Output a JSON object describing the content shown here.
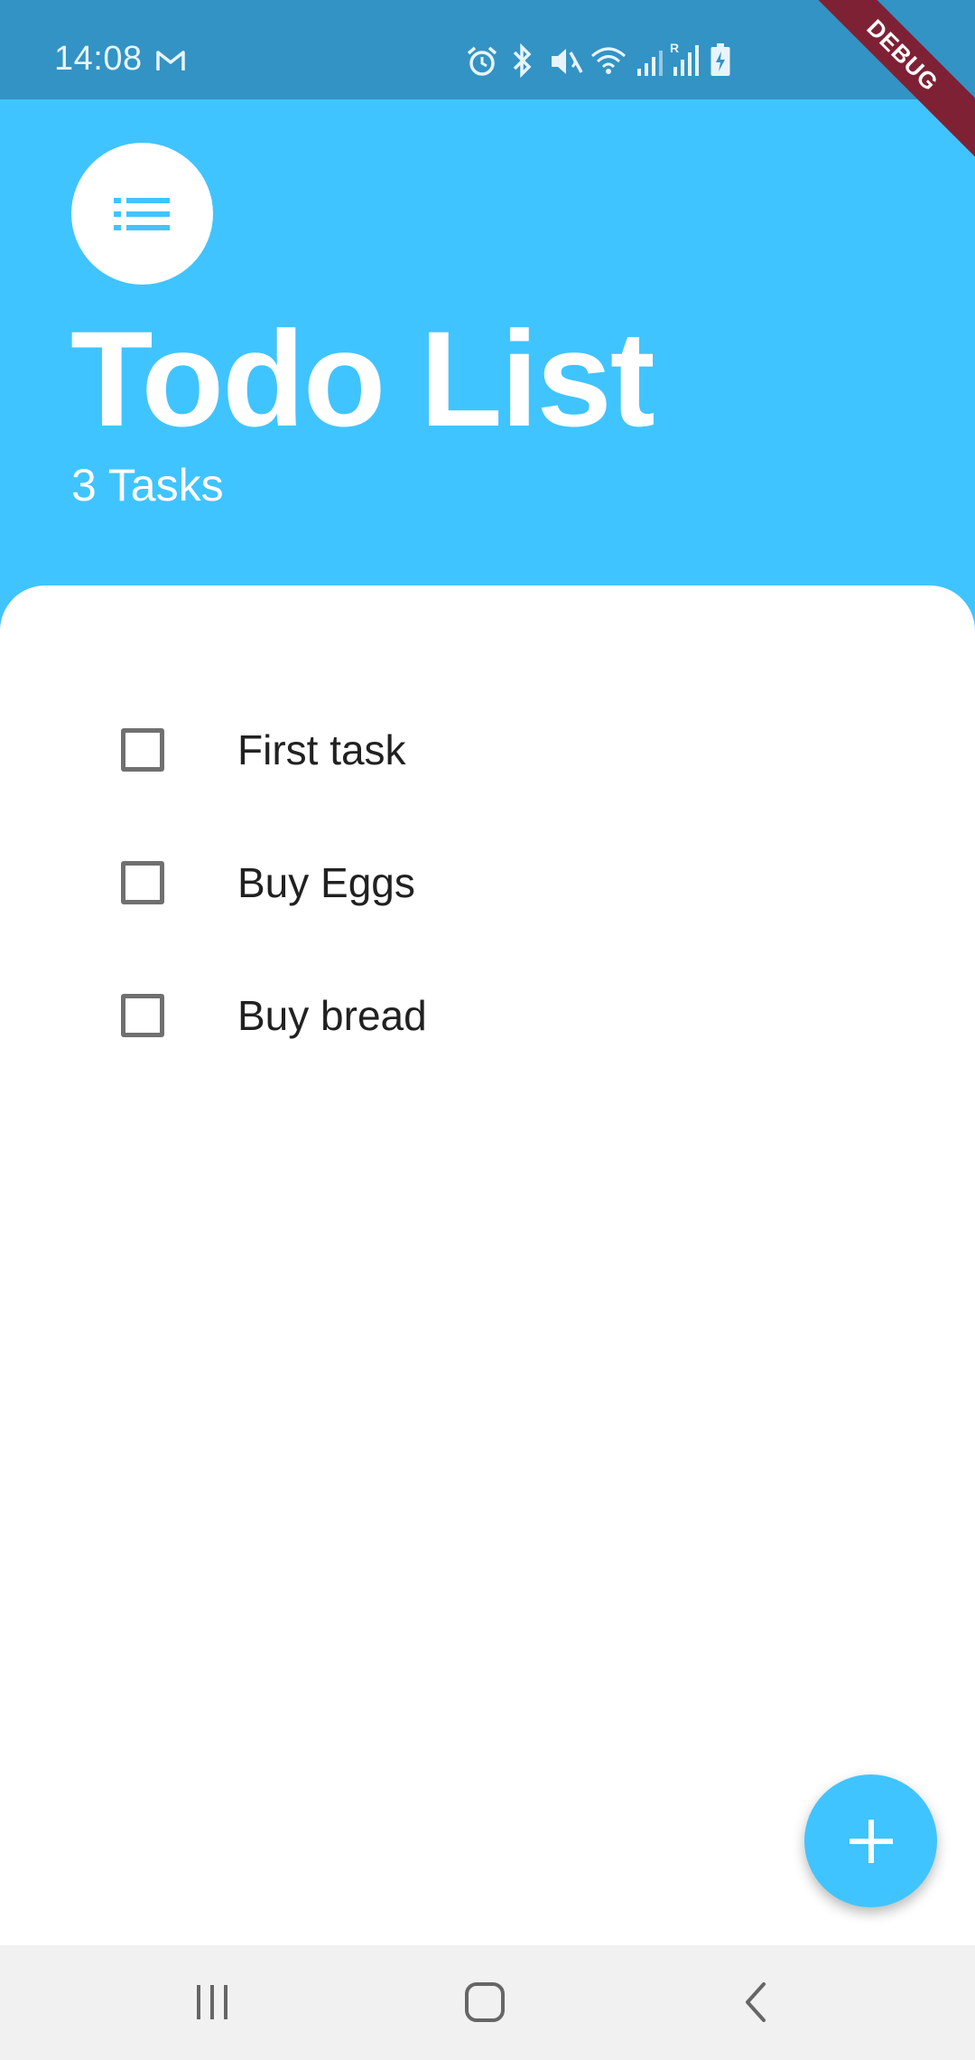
{
  "status_bar": {
    "time": "14:08",
    "icons": [
      "gmail-icon",
      "alarm-icon",
      "bluetooth-icon",
      "mute-icon",
      "wifi-icon",
      "signal-icon",
      "roaming-signal-icon",
      "battery-charging-icon"
    ]
  },
  "debug_banner": {
    "label": "DEBUG"
  },
  "header": {
    "title": "Todo List",
    "task_count": "3 Tasks",
    "menu_icon": "list-icon"
  },
  "tasks": [
    {
      "label": "First task",
      "checked": false
    },
    {
      "label": "Buy Eggs",
      "checked": false
    },
    {
      "label": "Buy bread",
      "checked": false
    }
  ],
  "fab": {
    "icon": "plus-icon"
  },
  "nav_bar": {
    "buttons": [
      "recent-apps-icon",
      "home-icon",
      "back-icon"
    ]
  },
  "colors": {
    "accent": "#40c4ff",
    "status_bar": "#3393c4",
    "debug_banner": "#7f2135",
    "checkbox_border": "#707070",
    "task_text": "#212121",
    "nav_bar": "#f1f1f1"
  }
}
